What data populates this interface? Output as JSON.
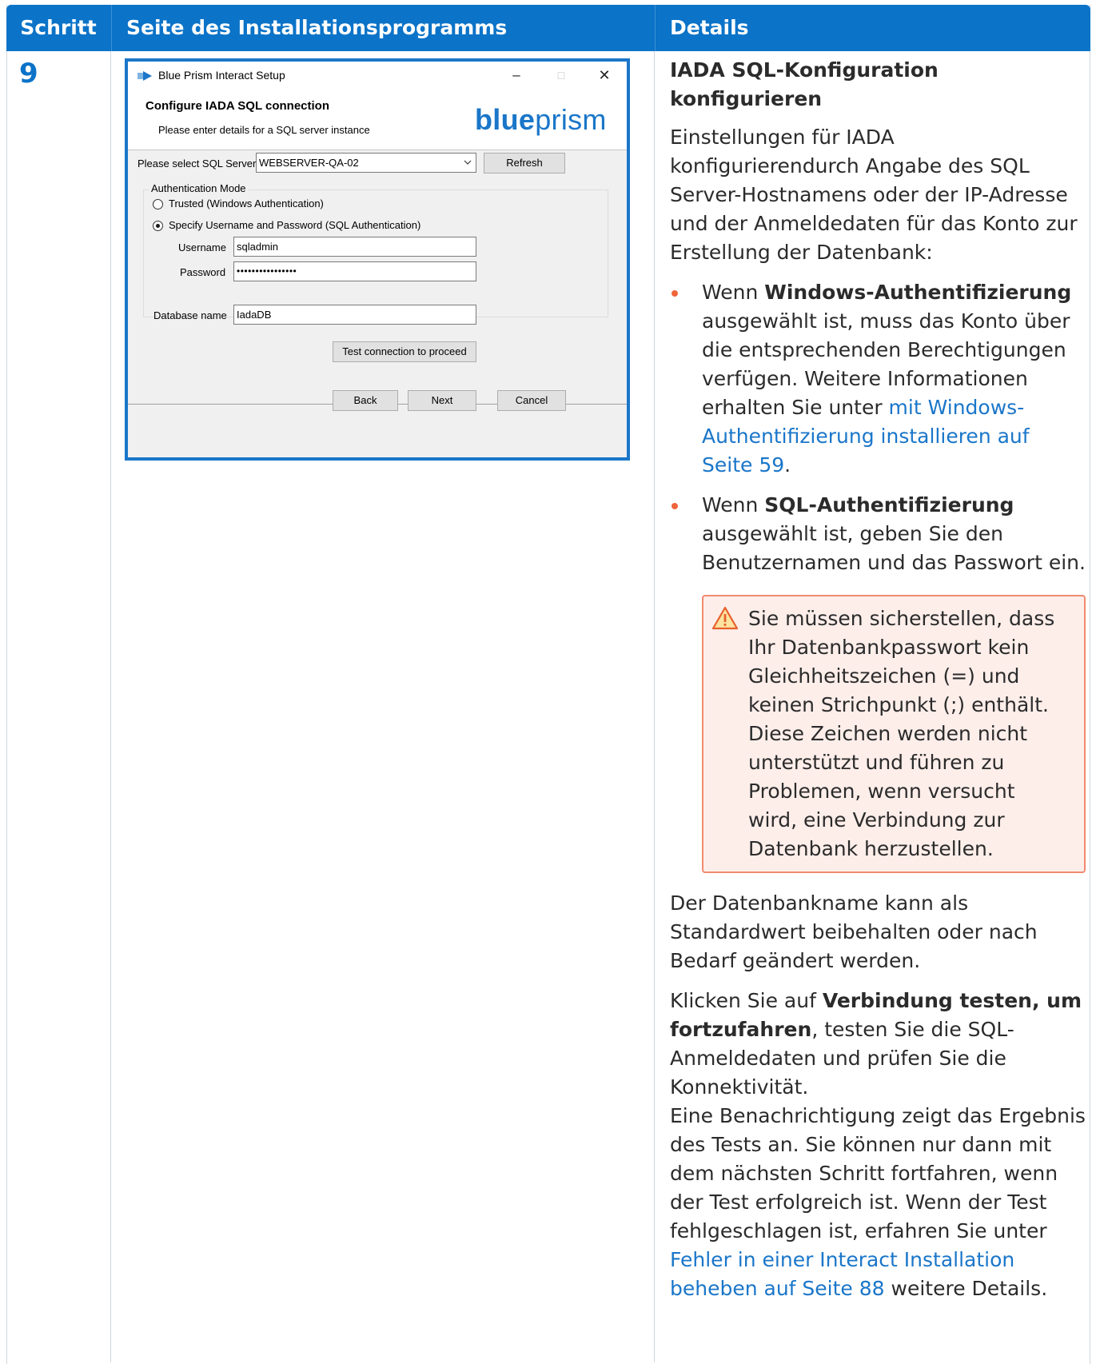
{
  "table": {
    "header": {
      "step": "Schritt",
      "page": "Seite des Installationsprogramms",
      "details": "Details"
    },
    "step_number": "9"
  },
  "dialog": {
    "window_title": "Blue Prism Interact Setup",
    "heading": "Configure IADA SQL connection",
    "subheading": "Please enter details for a SQL server instance",
    "brand_bold": "blue",
    "brand_light": "prism",
    "sql_server_label": "Please select SQL Server",
    "sql_server_value": "WEBSERVER-QA-02",
    "refresh_label": "Refresh",
    "auth_mode_label": "Authentication Mode",
    "radio_trusted": "Trusted (Windows Authentication)",
    "radio_specify": "Specify Username and Password (SQL Authentication)",
    "username_label": "Username",
    "username_value": "sqladmin",
    "password_label": "Password",
    "password_value": "••••••••••••••••",
    "database_label": "Database name",
    "database_value": "IadaDB",
    "test_button": "Test connection to proceed",
    "back_button": "Back",
    "next_button": "Next",
    "cancel_button": "Cancel",
    "window_buttons": {
      "minimize": "–",
      "maximize": "□",
      "close": "✕"
    }
  },
  "details": {
    "heading": "IADA SQL-Konfiguration konfigurieren",
    "intro": "Einstellungen für IADA konfigurierendurch Angabe des SQL Server-Hostnamens oder der IP-Adresse und der Anmeldedaten für das Konto zur Erstellung der Datenbank:",
    "bullets": [
      {
        "pre": "Wenn ",
        "bold": "Windows-Authentifizierung",
        "post": " ausgewählt ist, muss das Konto über die entsprechenden Berechtigungen verfügen. Weitere Informationen erhalten Sie unter ",
        "link": "mit Windows-Authentifizierung installieren auf Seite 59",
        "end": "."
      },
      {
        "pre": "Wenn ",
        "bold": "SQL-Authentifizierung",
        "post": " ausgewählt ist, geben Sie den Benutzernamen und das Passwort ein.",
        "link": "",
        "end": ""
      }
    ],
    "warning": "Sie müssen sicherstellen, dass Ihr Datenbankpasswort kein Gleichheitszeichen (=) und keinen Strichpunkt (;) enthält. Diese Zeichen werden nicht unterstützt und führen zu Problemen, wenn versucht wird, eine Verbindung zur Datenbank herzustellen.",
    "db_name_text": "Der Datenbankname kann als Standardwert beibehalten oder nach Bedarf geändert werden.",
    "click_pre": "Klicken Sie auf ",
    "click_bold": "Verbindung testen, um fortzufahren",
    "click_post": ", testen Sie die SQL-Anmeldedaten und prüfen Sie die Konnektivität.",
    "result_text": "Eine Benachrichtigung zeigt das Ergebnis des Tests an. Sie können nur dann mit dem nächsten Schritt fortfahren, wenn der Test erfolgreich ist. Wenn der Test fehlgeschlagen ist, erfahren Sie unter ",
    "result_link": "Fehler in einer Interact Installation beheben auf Seite 88",
    "result_end": " weitere Details."
  },
  "colors": {
    "header_blue": "#0b73c8",
    "link_blue": "#1a76c9",
    "bullet_orange": "#f0643c",
    "warning_border": "#f08a70",
    "warning_bg": "#fdeeea"
  }
}
